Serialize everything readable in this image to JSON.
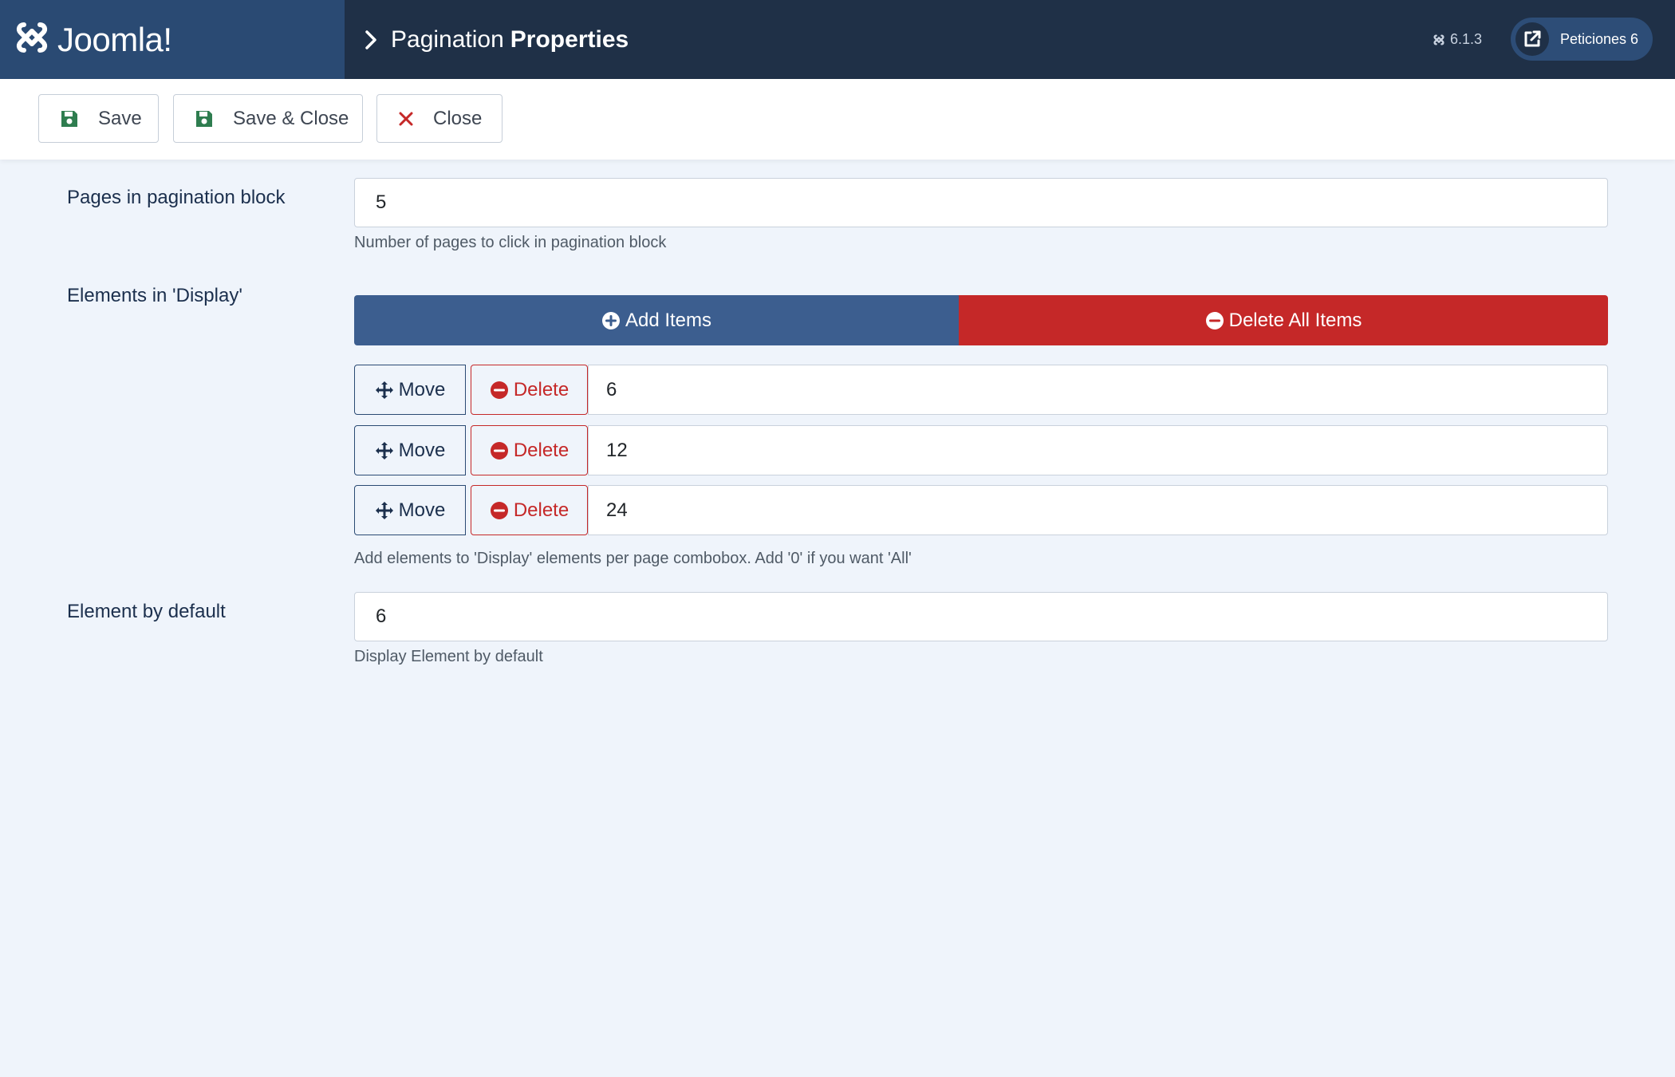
{
  "header": {
    "logo_text": "Joomla!",
    "title_prefix": "Pagination",
    "title_bold": "Properties",
    "version": "6.1.3",
    "peticiones_label": "Peticiones 6"
  },
  "toolbar": {
    "save_label": "Save",
    "save_close_label": "Save & Close",
    "close_label": "Close"
  },
  "form": {
    "pages_block": {
      "label": "Pages in pagination block",
      "value": "5",
      "help": "Number of pages to click in pagination block"
    },
    "display_elements": {
      "label": "Elements in 'Display'",
      "add_label": "Add Items",
      "delete_all_label": "Delete All Items",
      "items": [
        {
          "move_label": "Move",
          "delete_label": "Delete",
          "value": "6"
        },
        {
          "move_label": "Move",
          "delete_label": "Delete",
          "value": "12"
        },
        {
          "move_label": "Move",
          "delete_label": "Delete",
          "value": "24"
        }
      ],
      "help": "Add elements to 'Display' elements per page combobox. Add '0' if you want 'All'"
    },
    "default_element": {
      "label": "Element by default",
      "value": "6",
      "help": "Display Element by default"
    }
  },
  "colors": {
    "header_bg": "#1f3047",
    "logo_bg": "#2a4a73",
    "page_bg": "#eff4fb",
    "add_button": "#3c5e8f",
    "danger": "#c52828",
    "save_icon": "#2e7d4f"
  },
  "icons": {
    "logo": "joomla-logo-icon",
    "breadcrumb": "chevron-right-icon",
    "version": "joomla-small-icon",
    "external": "external-link-icon",
    "save": "floppy-disk-icon",
    "close": "x-icon",
    "add": "plus-circle-icon",
    "delete": "minus-circle-icon",
    "move": "move-arrows-icon"
  }
}
